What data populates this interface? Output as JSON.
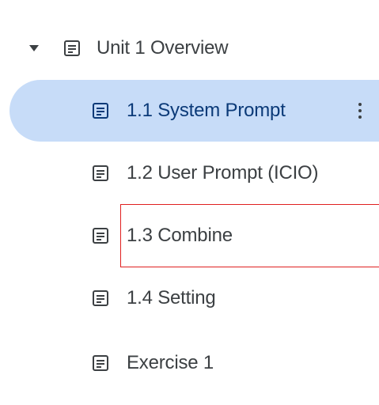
{
  "outline": {
    "parent": {
      "label": "Unit 1 Overview",
      "expanded": true,
      "icon": "document-icon",
      "toggle_icon": "caret-down-icon"
    },
    "items": [
      {
        "label": "1.1 System Prompt",
        "icon": "document-icon",
        "selected": true,
        "menu_icon": "more-vert-icon"
      },
      {
        "label": "1.2 User Prompt (ICIO)",
        "icon": "document-icon",
        "selected": false
      },
      {
        "label": "1.3 Combine",
        "icon": "document-icon",
        "selected": false,
        "annotated": true
      },
      {
        "label": "1.4 Setting",
        "icon": "document-icon",
        "selected": false
      },
      {
        "label": "Exercise 1",
        "icon": "document-icon",
        "selected": false
      }
    ]
  },
  "colors": {
    "selection_background": "#c7dcf8",
    "selected_text": "#0b3a78",
    "text": "#3c4043",
    "annotation_border": "#e02020"
  }
}
